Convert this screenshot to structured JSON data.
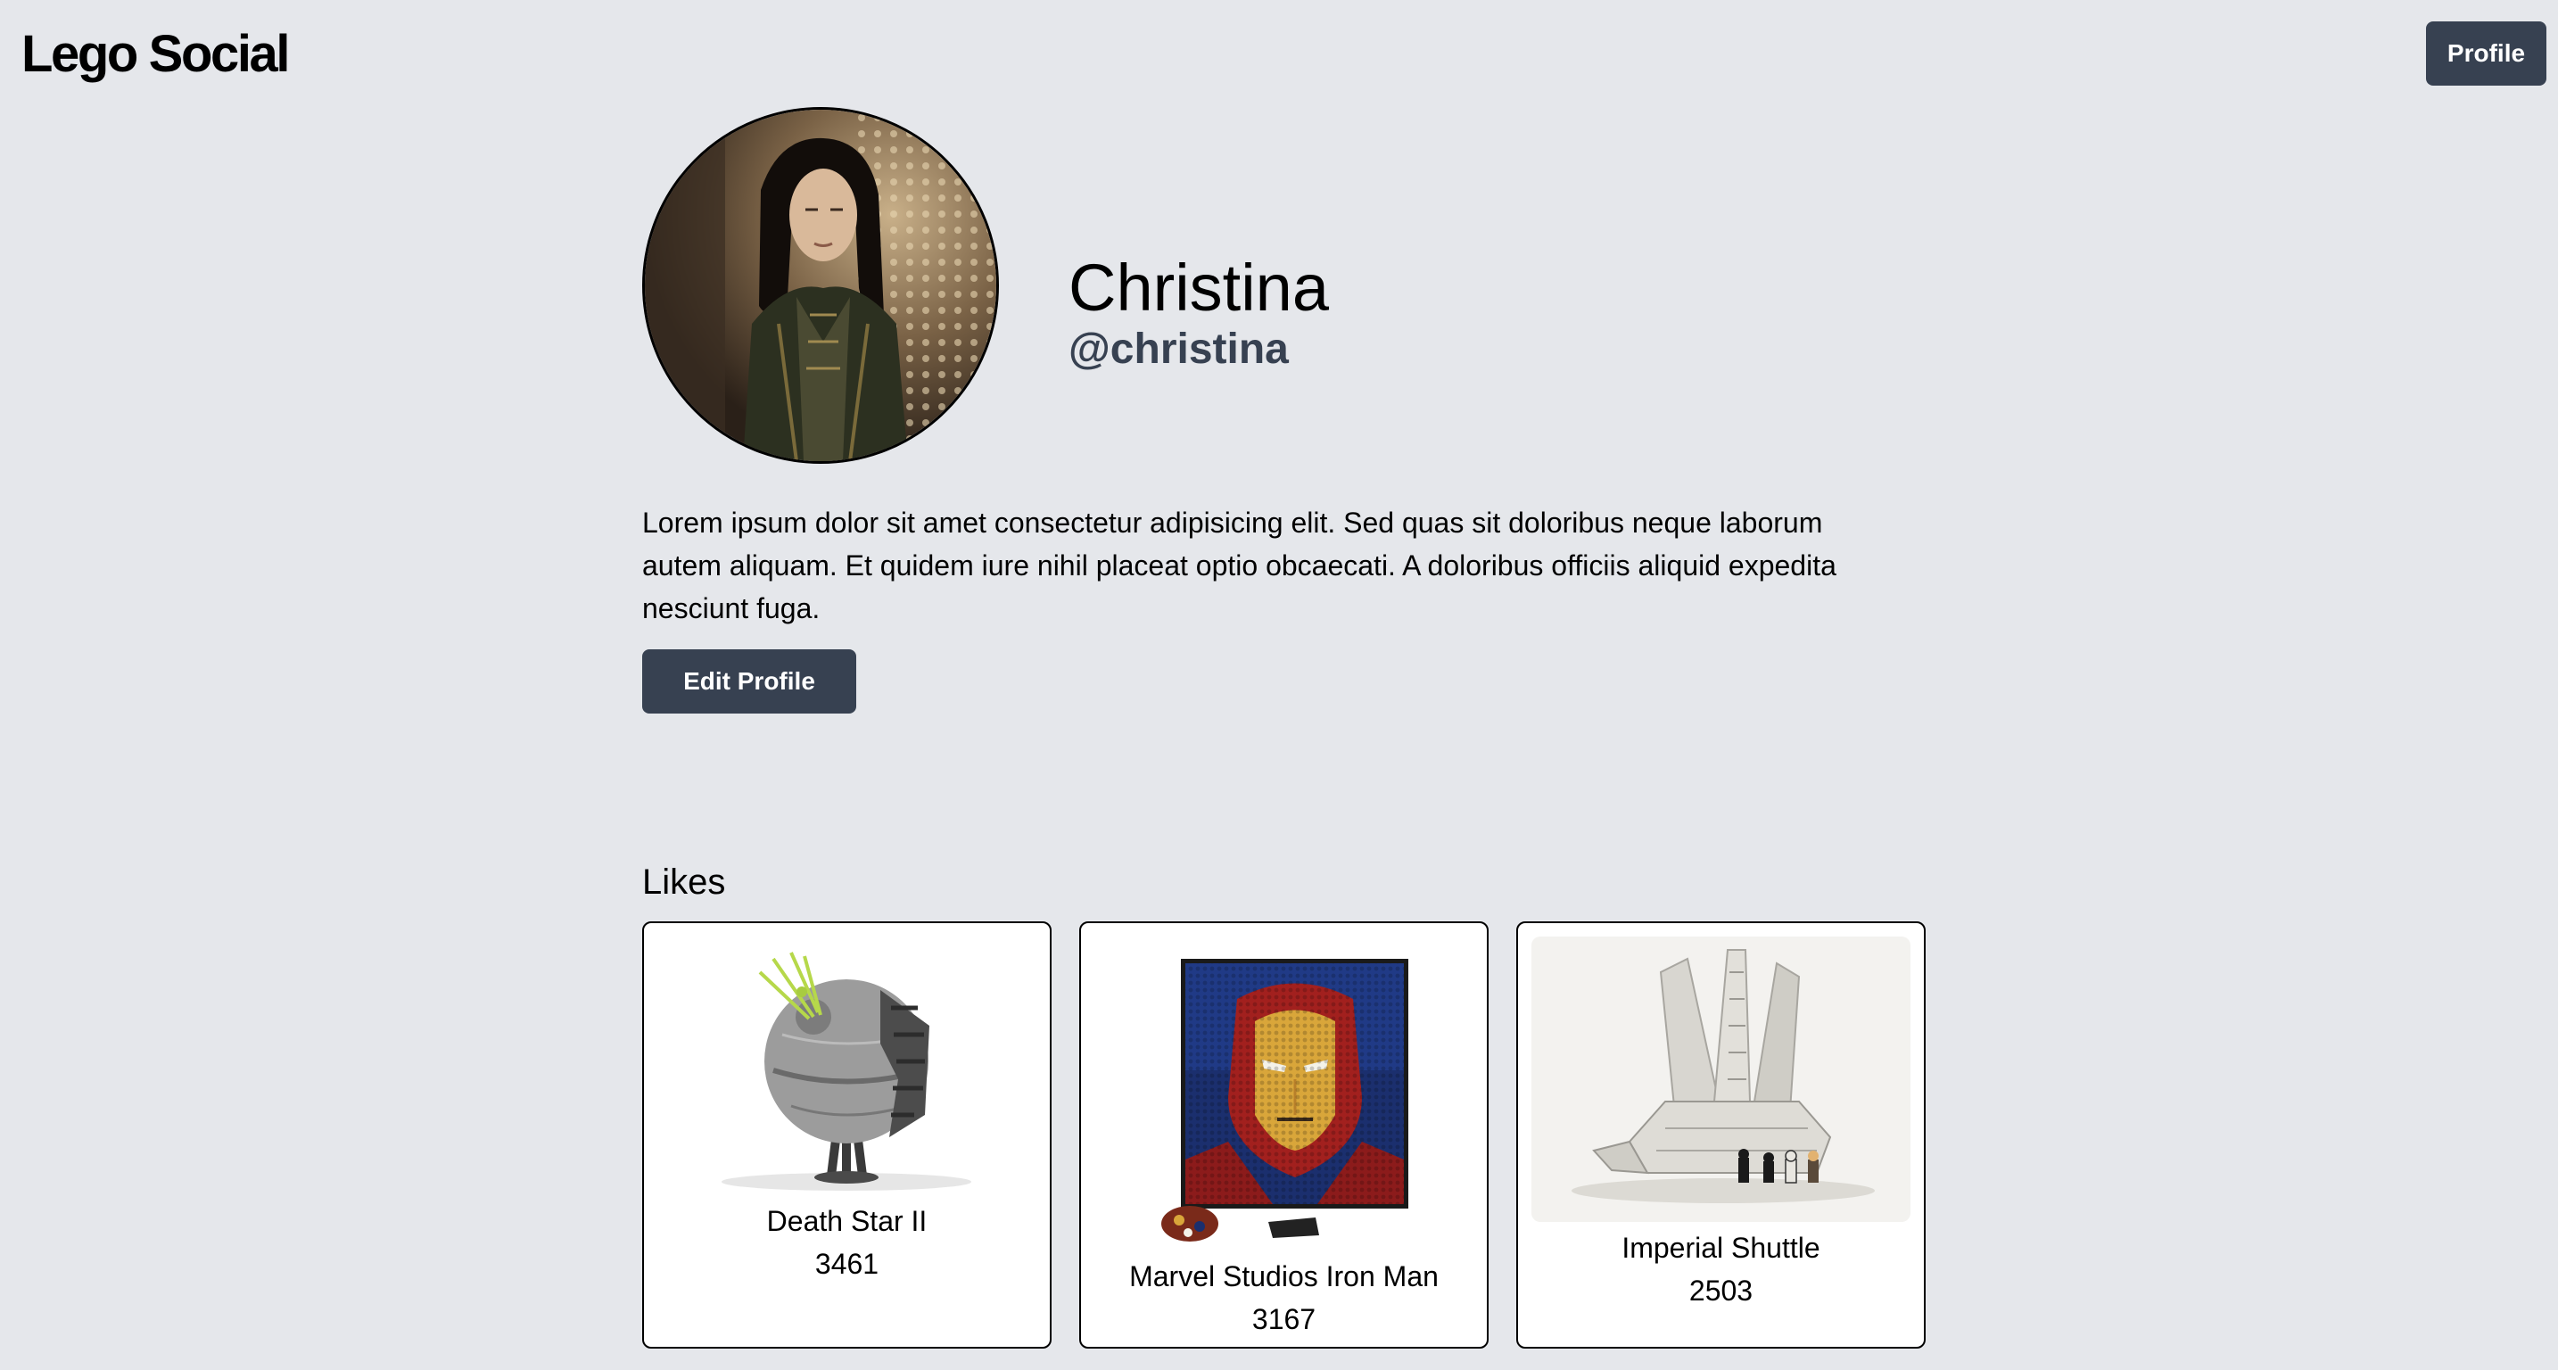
{
  "header": {
    "brand": "Lego Social",
    "profile_button": "Profile"
  },
  "profile": {
    "avatar_icon": "avatar-photo",
    "name": "Christina",
    "handle": "@christina",
    "bio": "Lorem ipsum dolor sit amet consectetur adipisicing elit. Sed quas sit doloribus neque laborum autem aliquam. Et quidem iure nihil placeat optio obcaecati. A doloribus officiis aliquid expedita nesciunt fuga.",
    "edit_button": "Edit Profile"
  },
  "likes": {
    "heading": "Likes",
    "items": [
      {
        "title": "Death Star II",
        "count": "3461",
        "icon": "death-star-image"
      },
      {
        "title": "Marvel Studios Iron Man",
        "count": "3167",
        "icon": "iron-man-mosaic-image"
      },
      {
        "title": "Imperial Shuttle",
        "count": "2503",
        "icon": "imperial-shuttle-image"
      }
    ]
  },
  "colors": {
    "background": "#e5e7eb",
    "button": "#374151",
    "handle": "#374151"
  }
}
